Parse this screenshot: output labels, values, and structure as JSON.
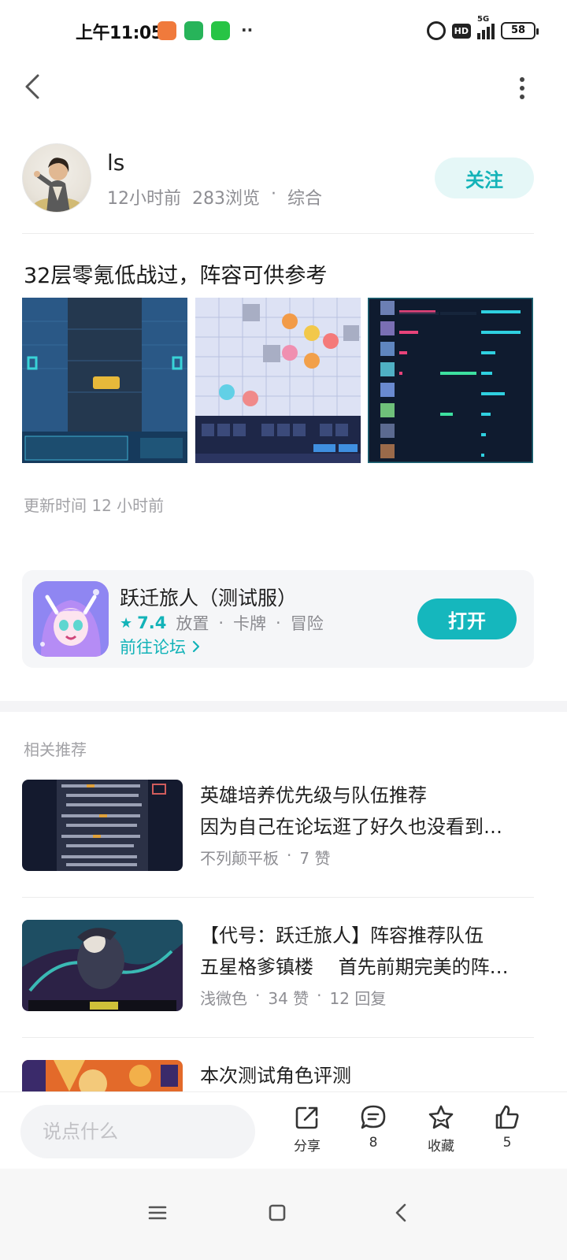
{
  "status_bar": {
    "time": "上午11:05",
    "dots": "··",
    "hd": "HD",
    "network": "5G",
    "battery": "58"
  },
  "author": {
    "name": "ls",
    "time_ago": "12小时前",
    "views": "283浏览",
    "separator": "·",
    "category": "综合",
    "follow_label": "关注"
  },
  "post": {
    "title": "32层零氪低战过，阵容可供参考",
    "update_time": "更新时间 12 小时前"
  },
  "game": {
    "name": "跃迁旅人（测试服）",
    "rating": "7.4",
    "tags": [
      "放置",
      "卡牌",
      "冒险"
    ],
    "forum_link": "前往论坛",
    "open_label": "打开"
  },
  "recommendations": {
    "header": "相关推荐",
    "items": [
      {
        "title": "英雄培养优先级与队伍推荐",
        "subtitle": "因为自己在论坛逛了好久也没看到…",
        "author": "不列颠平板",
        "likes": "7 赞",
        "replies": ""
      },
      {
        "title": "【代号：跃迁旅人】阵容推荐队伍",
        "subtitle": "五星格爹镇楼　 首先前期完美的阵…",
        "author": "浅微色",
        "likes": "34 赞",
        "replies": "12 回复"
      },
      {
        "title": "本次测试角色评测",
        "subtitle": "",
        "author": "",
        "likes": "",
        "replies": ""
      }
    ]
  },
  "action_bar": {
    "placeholder": "说点什么",
    "share_label": "分享",
    "comment_count": "8",
    "favorite_label": "收藏",
    "like_count": "5"
  },
  "colors": {
    "accent": "#15b7bd",
    "accent_light": "#e5f7f7",
    "muted_text": "#8e8e93"
  }
}
